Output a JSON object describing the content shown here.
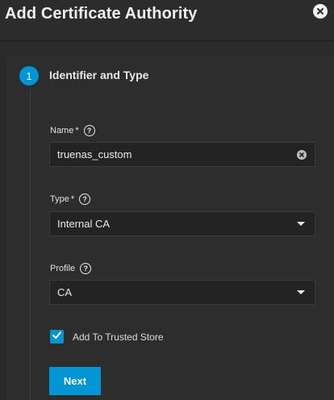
{
  "dialog": {
    "title": "Add Certificate Authority"
  },
  "stepper": {
    "step_number": "1",
    "step_title": "Identifier and Type"
  },
  "form": {
    "name": {
      "label": "Name",
      "required_marker": "*",
      "value": "truenas_custom"
    },
    "type": {
      "label": "Type",
      "required_marker": "*",
      "selected": "Internal CA"
    },
    "profile": {
      "label": "Profile",
      "selected": "CA"
    },
    "trusted_store": {
      "label": "Add To Trusted Store",
      "checked": true
    }
  },
  "actions": {
    "next_label": "Next"
  },
  "colors": {
    "accent": "#0095d5",
    "background": "#2a2a2a",
    "field_background": "#232323"
  },
  "icons": {
    "close": "close-icon",
    "help": "help-icon",
    "clear": "clear-icon",
    "dropdown": "chevron-down-icon",
    "check": "check-icon"
  }
}
